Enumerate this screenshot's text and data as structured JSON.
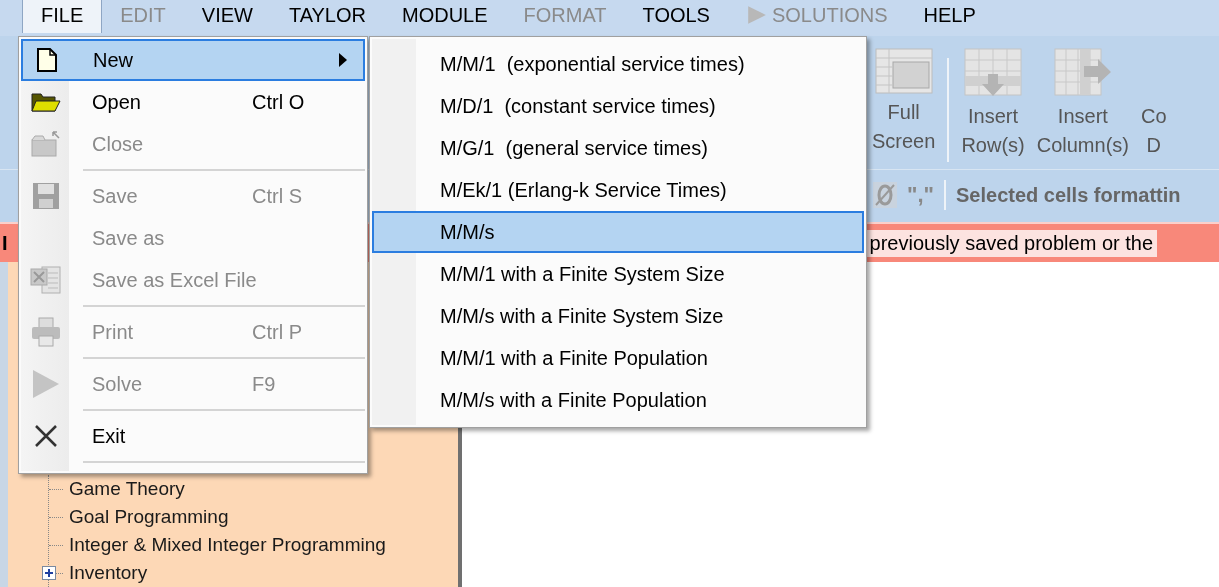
{
  "menu_bar": [
    {
      "label": "FILE",
      "selected": true,
      "disabled": false,
      "kind": "text"
    },
    {
      "label": "EDIT",
      "selected": false,
      "disabled": true,
      "kind": "text"
    },
    {
      "label": "VIEW",
      "selected": false,
      "disabled": false,
      "kind": "text"
    },
    {
      "label": "TAYLOR",
      "selected": false,
      "disabled": false,
      "kind": "text"
    },
    {
      "label": "MODULE",
      "selected": false,
      "disabled": false,
      "kind": "text"
    },
    {
      "label": "FORMAT",
      "selected": false,
      "disabled": true,
      "kind": "text"
    },
    {
      "label": "TOOLS",
      "selected": false,
      "disabled": false,
      "kind": "text"
    },
    {
      "label": "SOLUTIONS",
      "selected": false,
      "disabled": true,
      "kind": "play"
    },
    {
      "label": "HELP",
      "selected": false,
      "disabled": false,
      "kind": "text"
    }
  ],
  "toolbar": [
    {
      "lines": [
        "Full",
        "Screen"
      ],
      "kind": "fullscreen"
    },
    {
      "lines": [
        "Insert",
        "Row(s)"
      ],
      "kind": "insert-row"
    },
    {
      "lines": [
        "Insert",
        "Column(s)"
      ],
      "kind": "insert-column"
    },
    {
      "lines": [
        "Co",
        "D"
      ],
      "kind": "none"
    }
  ],
  "format_bar": {
    "separator_symbol": "\",\"",
    "status": "Selected cells formattin"
  },
  "message_bar": {
    "left_text": "I",
    "text": "previously saved problem or the"
  },
  "tree": [
    {
      "label": "Game Theory"
    },
    {
      "label": "Goal Programming"
    },
    {
      "label": "Integer & Mixed Integer Programming"
    },
    {
      "label": "Inventory",
      "expanded": false
    }
  ],
  "file_menu": [
    [
      {
        "label": "New",
        "kind": "new",
        "disabled": false,
        "selected": true,
        "submenu": true
      },
      {
        "label": "Open",
        "shortcut": "Ctrl O",
        "kind": "open",
        "disabled": false,
        "selected": false,
        "submenu": false
      },
      {
        "label": "Close",
        "kind": "close",
        "disabled": true,
        "selected": false,
        "submenu": false
      }
    ],
    [
      {
        "label": "Save",
        "shortcut": "Ctrl S",
        "kind": "save",
        "disabled": true,
        "selected": false,
        "submenu": false
      },
      {
        "label": "Save as",
        "kind": "none",
        "disabled": true,
        "selected": false,
        "submenu": false
      },
      {
        "label": "Save as Excel File",
        "kind": "excel",
        "disabled": true,
        "selected": false,
        "submenu": false
      }
    ],
    [
      {
        "label": "Print",
        "shortcut": "Ctrl P",
        "kind": "print",
        "disabled": true,
        "selected": false,
        "submenu": false
      }
    ],
    [
      {
        "label": "Solve",
        "shortcut": "F9",
        "kind": "solve",
        "disabled": true,
        "selected": false,
        "submenu": false
      }
    ],
    [
      {
        "label": "Exit",
        "kind": "exit",
        "disabled": false,
        "selected": false,
        "submenu": false
      }
    ]
  ],
  "new_submenu": [
    {
      "label": "M/M/1  (exponential service times)",
      "selected": false
    },
    {
      "label": "M/D/1  (constant service times)",
      "selected": false
    },
    {
      "label": "M/G/1  (general service times)",
      "selected": false
    },
    {
      "label": "M/Ek/1 (Erlang-k Service Times)",
      "selected": false
    },
    {
      "label": "M/M/s",
      "selected": true
    },
    {
      "label": "M/M/1 with a Finite System Size",
      "selected": false
    },
    {
      "label": "M/M/s with a Finite System Size",
      "selected": false
    },
    {
      "label": "M/M/1 with a Finite Population",
      "selected": false
    },
    {
      "label": "M/M/s with a Finite Population",
      "selected": false
    }
  ]
}
